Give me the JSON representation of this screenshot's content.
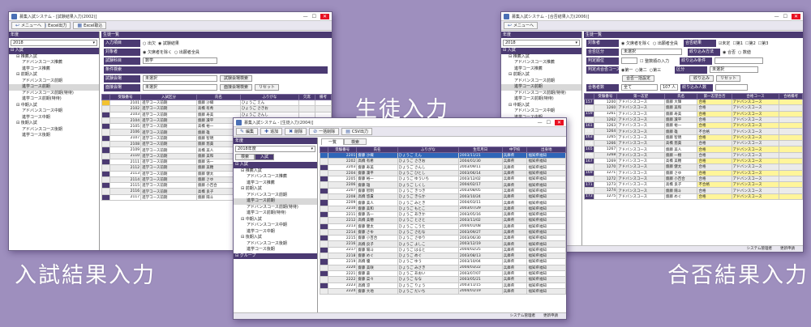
{
  "captions": {
    "left": "入試結果入力",
    "center": "生徒入力",
    "right": "合否結果入力"
  },
  "win1": {
    "title": "募集入試システム - [試験結果入力(2002)]",
    "menu": [
      "更新",
      "Excel出力",
      "Excel取込"
    ],
    "menu_right": "メニューへ",
    "left_header": "年度",
    "year": "2018",
    "tree": [
      "入試",
      "推薦入試",
      "アドバンスコース推薦",
      "進学コース推薦",
      "前期入試",
      "アドバンスコース前期",
      "進学コース前期",
      "アドバンスコース前期(特待)",
      "進学コース前期(特待)",
      "中期入試",
      "アドバンスコース中期",
      "進学コース中期",
      "後期入試",
      "アドバンスコース後期",
      "進学コース後期"
    ],
    "right_header": "生徒一覧",
    "f1_label": "入力項目",
    "f1_opt1": "出欠",
    "f1_opt2": "試験結果",
    "f2_label": "対象者",
    "f2_opt1": "欠席者を除く",
    "f2_opt2": "出願者全員",
    "f3_label": "試験科目",
    "f3_value": "数学",
    "cond_header": "条件検索",
    "f4_label": "試験会場",
    "f4_value": "未選択",
    "f4_btn": "試験会場検索",
    "f5_label": "面接会場",
    "f5_value": "未選択",
    "f5_btn": "面接会場検索",
    "reset": "リセット",
    "cols": [
      "受験番号",
      "入試区分",
      "氏名",
      "ふりがな",
      "欠席",
      "備考"
    ],
    "rows": [
      [
        "2101",
        "進学コース前期",
        "齋藤 沙織",
        "ひょうご えん"
      ],
      [
        "2102",
        "進学コース前期",
        "高橋 有希",
        "ひょうご さきお"
      ],
      [
        "2103",
        "進学コース前期",
        "齋藤 寿美",
        "ひょうご さんし"
      ],
      [
        "2104",
        "進学コース前期",
        "齋藤 凜平",
        "ひょうご ひとし"
      ],
      [
        "2105",
        "進学コース前期",
        "高橋 裕一",
        "ひょうご さらか"
      ],
      [
        "2106",
        "進学コース前期",
        "齋藤 雄",
        "ひょうご しくし"
      ],
      [
        "2107",
        "進学コース前期",
        "齋藤 智明",
        "ひょうご きつき"
      ],
      [
        "2108",
        "進学コース前期",
        "齋藤 悠貴",
        "ひょうご きらか"
      ],
      [
        "2109",
        "進学コース前期",
        "高橋 美人",
        "ひょうご みとき"
      ],
      [
        "2110",
        "進学コース前期",
        "齋藤 美和",
        "ひょうご もとこ"
      ],
      [
        "2111",
        "進学コース前期",
        "齋藤 浩一",
        "ひょうご あきか"
      ],
      [
        "2112",
        "進学コース前期",
        "齋藤 美穂",
        "ひょうご とさと"
      ],
      [
        "2113",
        "進学コース前期",
        "齋藤 健太",
        "ひょうご こうた"
      ],
      [
        "2114",
        "進学コース前期",
        "齋藤 さゆ",
        "ひょうご さむな"
      ],
      [
        "2115",
        "進学コース前期",
        "齋藤 小百合",
        "ひょうご さゆり"
      ],
      [
        "2116",
        "進学コース前期",
        "高橋 良子",
        "ひょうご よしこ"
      ],
      [
        "2117",
        "進学コース前期",
        "齋藤 陽斗",
        "ひょうご はると"
      ]
    ]
  },
  "win2": {
    "title": "募集入試システム - [生徒入力(2004)]",
    "menu": [
      "編集",
      "追加",
      "削除",
      "一括削除",
      "CSV出力"
    ],
    "left_header": "年度",
    "year": "2018年度",
    "tabs": [
      "検索",
      "入試"
    ],
    "tree": [
      "入試",
      "推薦入試",
      "アドバンスコース推薦",
      "進学コース推薦",
      "前期入試",
      "アドバンスコース前期",
      "進学コース前期",
      "アドバンスコース前期(特待)",
      "進学コース前期(特待)",
      "中期入試",
      "アドバンスコース中期",
      "進学コース中期",
      "後期入試",
      "アドバンスコース後期",
      "進学コース後期",
      "グループ"
    ],
    "rtabs": [
      "一覧",
      "検索"
    ],
    "cols": [
      "受験番号",
      "氏名",
      "ふりがな",
      "生年月日",
      "中学校",
      "出身地"
    ],
    "rows": [
      [
        "2201",
        "齋藤 沙織",
        "ひょうご えん",
        "2003/11/21",
        "兵庫県",
        "福知県福知"
      ],
      [
        "2202",
        "高橋 有希",
        "ひょうご さきお",
        "2004/01/30",
        "兵庫県",
        "福知県福知"
      ],
      [
        "2203",
        "齋藤 寿美",
        "ひょうご さんし",
        "2003/09/11",
        "兵庫県",
        "福知県福知"
      ],
      [
        "2204",
        "齋藤 凜平",
        "ひょうご ひとし",
        "2003/06/14",
        "兵庫県",
        "福知県福知"
      ],
      [
        "2205",
        "齋藤 裕一",
        "ひょうご ゆういち",
        "2003/12/02",
        "兵庫県",
        "福知県福知"
      ],
      [
        "2206",
        "齋藤 雄",
        "ひょうご しくし",
        "2004/02/17",
        "兵庫県",
        "福知県福知"
      ],
      [
        "2207",
        "齋藤 智明",
        "ひょうご きつき",
        "2003/08/05",
        "兵庫県",
        "福知県福知"
      ],
      [
        "2208",
        "高橋 悠貴",
        "ひょうご きらか",
        "2003/10/24",
        "兵庫県",
        "福知県福知"
      ],
      [
        "2209",
        "齋藤 美人",
        "ひょうご みとき",
        "2004/03/11",
        "兵庫県",
        "福知県福知"
      ],
      [
        "2210",
        "齋藤 美和",
        "ひょうご もとこ",
        "2003/07/29",
        "兵庫県",
        "福知県福知"
      ],
      [
        "2211",
        "齋藤 浩一",
        "ひょうご あきか",
        "2003/05/16",
        "兵庫県",
        "福知県福知"
      ],
      [
        "2212",
        "高橋 美穂",
        "ひょうご とさと",
        "2003/11/02",
        "兵庫県",
        "福知県福知"
      ],
      [
        "2213",
        "齋藤 健太",
        "ひょうご こうた",
        "2004/01/08",
        "兵庫県",
        "福知県福知"
      ],
      [
        "2214",
        "齋藤 さゆ",
        "ひょうご さむな",
        "2003/09/27",
        "兵庫県",
        "福知県福知"
      ],
      [
        "2215",
        "齋藤 小百合",
        "ひょうご さゆり",
        "2003/06/30",
        "兵庫県",
        "福知県福知"
      ],
      [
        "2216",
        "高橋 良子",
        "ひょうご よしこ",
        "2003/12/19",
        "兵庫県",
        "福知県福知"
      ],
      [
        "2217",
        "齋藤 陽斗",
        "ひょうご はると",
        "2004/02/25",
        "兵庫県",
        "福知県福知"
      ],
      [
        "2218",
        "齋藤 めぐ",
        "ひょうご めぐ",
        "2003/08/13",
        "兵庫県",
        "福知県福知"
      ],
      [
        "2219",
        "高橋 優",
        "ひょうご ゆう",
        "2003/10/04",
        "兵庫県",
        "福知県福知"
      ],
      [
        "2220",
        "齋藤 美咲",
        "ひょうご みさき",
        "2004/03/22",
        "兵庫県",
        "福知県福知"
      ],
      [
        "2221",
        "齋藤 蒼",
        "ひょうご あおい",
        "2003/07/07",
        "兵庫県",
        "福知県福知"
      ],
      [
        "2222",
        "齋藤 菜々",
        "ひょうご なな",
        "2003/05/21",
        "兵庫県",
        "福知県福知"
      ],
      [
        "2223",
        "高橋 涼",
        "ひょうご りょう",
        "2003/11/15",
        "兵庫県",
        "福知県福知"
      ],
      [
        "2224",
        "齋藤 大地",
        "ひょうご だいち",
        "2004/01/19",
        "兵庫県",
        "福知県福知"
      ]
    ],
    "status": [
      "システム管理者",
      "更新申請"
    ]
  },
  "win3": {
    "title": "募集入試システム - [合否結果入力(2006)]",
    "menu": [
      "更新"
    ],
    "menu_right": "メニューへ",
    "left_header": "年度",
    "year": "2018",
    "tree": [
      "入試",
      "推薦入試",
      "アドバンスコース推薦",
      "進学コース推薦",
      "前期入試",
      "アドバンスコース前期",
      "進学コース前期",
      "アドバンスコース前期(特待)",
      "進学コース前期(特待)",
      "中期入試",
      "アドバンスコース中期",
      "進学コース中期",
      "後期入試",
      "アドバンスコース後期",
      "進学コース後期"
    ],
    "right_header": "生徒一覧",
    "f1_label": "対象者",
    "f1_opt1": "欠席者を除く",
    "f1_opt2": "出願者全員",
    "f1b_label": "合否結果",
    "f1b_opts": [
      "未定",
      "第1",
      "第2",
      "第3"
    ],
    "f2_label": "合否区分",
    "f2_value": "未選択",
    "f2b_label": "絞り込み方法",
    "f2b_opt1": "合否",
    "f2b_opt2": "数値",
    "f3_label": "判定順位",
    "f3_chk": "整数順の入力",
    "f3b_label": "絞り込み条件",
    "f4_label": "判定点合否コース",
    "f4_opts": [
      "第一",
      "第二",
      "第三"
    ],
    "f4b_label": "区分",
    "f4b_value": "未選択",
    "btn1": "合否一括設定",
    "btn2": "絞り込み",
    "btn3": "リセット",
    "f5_label": "合格者数",
    "f5_value": "全て",
    "f5_num": "107 人",
    "f5b_label": "絞り込み人数",
    "cols": [
      "受験番号",
      "第一志望",
      "氏名",
      "第一志望合否",
      "合格コース",
      "合格備考"
    ],
    "rows": [
      [
        "1200",
        "アドバンスコース",
        "齋藤 大輝",
        "合格",
        "アドバンスコース"
      ],
      [
        "1260",
        "アドバンスコース",
        "齋藤 美和",
        "合格",
        "アドバンスコース"
      ],
      [
        "1261",
        "アドバンスコース",
        "齋藤 寿美",
        "合格",
        "アドバンスコース"
      ],
      [
        "1262",
        "アドバンスコース",
        "齋藤 凜平",
        "合格",
        "アドバンスコース"
      ],
      [
        "1263",
        "アドバンスコース",
        "齋藤 裕一",
        "合格",
        "アドバンスコース"
      ],
      [
        "1264",
        "アドバンスコース",
        "齋藤 雄",
        "不合格",
        "アドバンスコース"
      ],
      [
        "1265",
        "アドバンスコース",
        "齋藤 智明",
        "合格",
        "アドバンスコース"
      ],
      [
        "1266",
        "アドバンスコース",
        "高橋 悠貴",
        "合格",
        "アドバンスコース"
      ],
      [
        "1267",
        "アドバンスコース",
        "齋藤 美人",
        "合格",
        "アドバンスコース"
      ],
      [
        "1268",
        "アドバンスコース",
        "齋藤 一樹",
        "合格",
        "アドバンスコース"
      ],
      [
        "1269",
        "アドバンスコース",
        "高橋 美穂",
        "合格",
        "アドバンスコース"
      ],
      [
        "1270",
        "アドバンスコース",
        "齋藤 健太",
        "合格",
        "アドバンスコース"
      ],
      [
        "1271",
        "アドバンスコース",
        "齋藤 さゆ",
        "合格",
        "アドバンスコース"
      ],
      [
        "1272",
        "アドバンスコース",
        "齋藤 小百合",
        "合格",
        "アドバンスコース"
      ],
      [
        "1273",
        "アドバンスコース",
        "高橋 良子",
        "不合格",
        "アドバンスコース"
      ],
      [
        "1274",
        "アドバンスコース",
        "齋藤 陽斗",
        "合格",
        "アドバンスコース"
      ],
      [
        "1275",
        "アドバンスコース",
        "齋藤 めぐ",
        "合格",
        "アドバンスコース"
      ]
    ],
    "status": [
      "システム管理者",
      "更新申請"
    ]
  }
}
